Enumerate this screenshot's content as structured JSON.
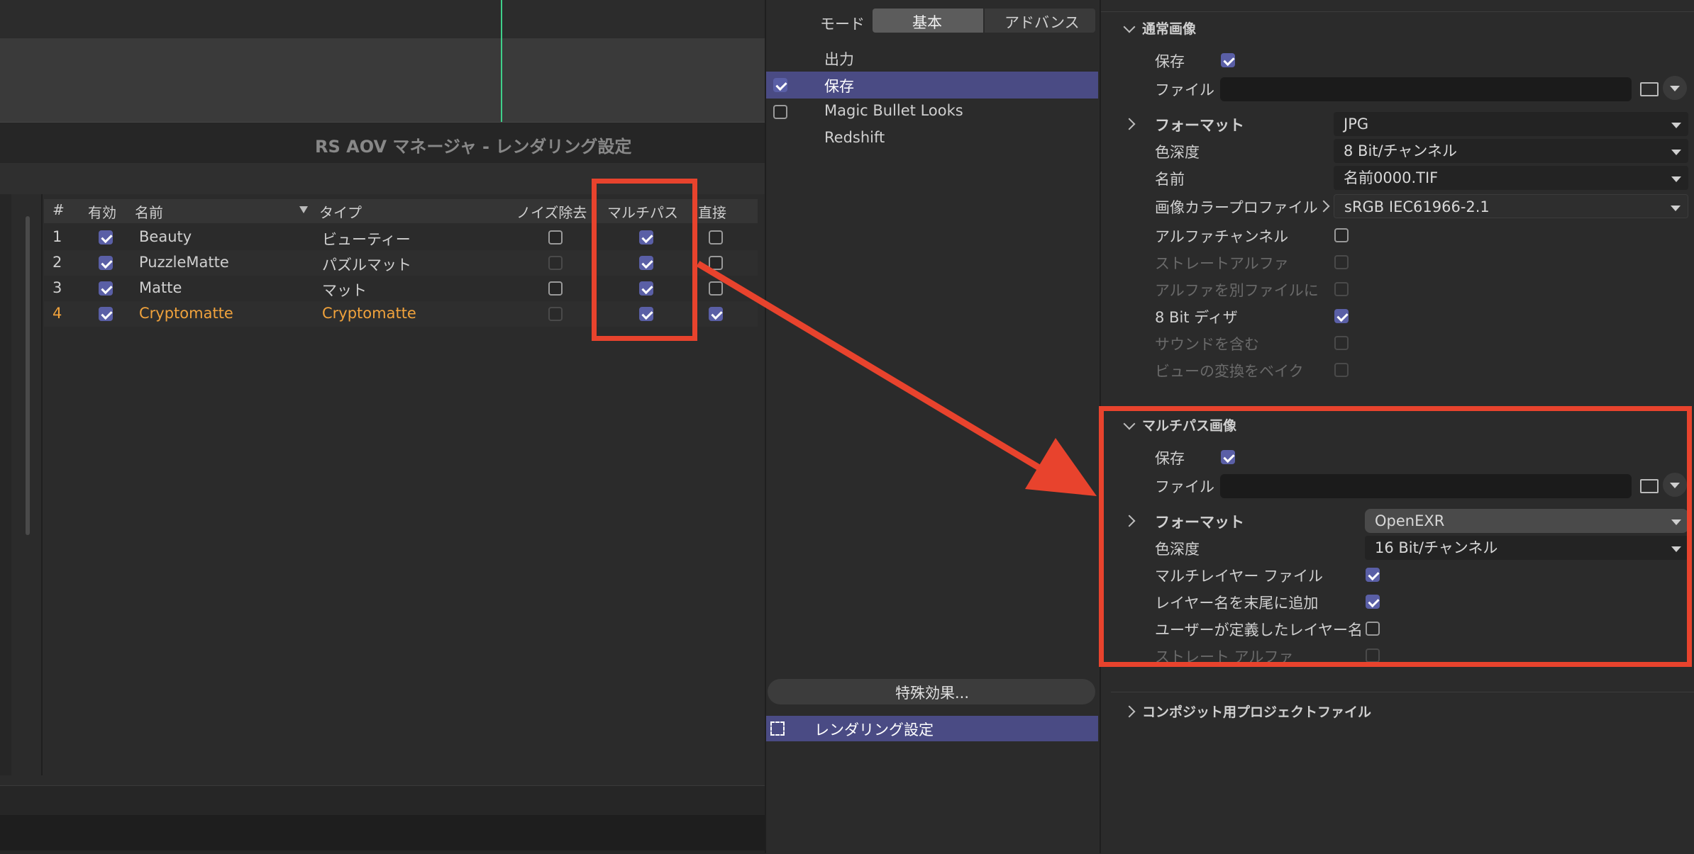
{
  "aov_manager": {
    "title": "RS AOV マネージャ - レンダリング設定",
    "columns": {
      "num": "#",
      "enabled": "有効",
      "name": "名前",
      "type": "タイプ",
      "denoise": "ノイズ除去",
      "multipass": "マルチパス",
      "direct": "直接"
    },
    "rows": [
      {
        "num": "1",
        "name": "Beauty",
        "type": "ビューティー",
        "enabled": true,
        "denoise": "off",
        "multipass": true,
        "direct": "off"
      },
      {
        "num": "2",
        "name": "PuzzleMatte",
        "type": "パズルマット",
        "enabled": true,
        "denoise": "disabled",
        "multipass": true,
        "direct": "off"
      },
      {
        "num": "3",
        "name": "Matte",
        "type": "マット",
        "enabled": true,
        "denoise": "off",
        "multipass": true,
        "direct": "off"
      },
      {
        "num": "4",
        "name": "Cryptomatte",
        "type": "Cryptomatte",
        "enabled": true,
        "denoise": "disabled",
        "multipass": true,
        "direct": "on",
        "highlight_color": "#f0a23c"
      }
    ]
  },
  "render_settings": {
    "mode_label": "モード",
    "mode_tabs": [
      "基本",
      "アドバンス"
    ],
    "active_mode": "基本",
    "list": [
      {
        "label": "出力",
        "checkbox": "none"
      },
      {
        "label": "保存",
        "checkbox": "on",
        "selected": true
      },
      {
        "label": "Magic Bullet Looks",
        "checkbox": "off"
      },
      {
        "label": "Redshift",
        "checkbox": "none"
      }
    ],
    "effects_button": "特殊効果...",
    "preset": "レンダリング設定"
  },
  "regular_image": {
    "section_title": "通常画像",
    "save_label": "保存",
    "file_label": "ファイル",
    "format_label": "フォーマット",
    "format_value": "JPG",
    "depth_label": "色深度",
    "depth_value": "8 Bit/チャンネル",
    "name_label": "名前",
    "name_value": "名前0000.TIF",
    "profile_label": "画像カラープロファイル",
    "profile_value": "sRGB IEC61966-2.1",
    "alpha_label": "アルファチャンネル",
    "straight_alpha_label": "ストレートアルファ",
    "separate_alpha_label": "アルファを別ファイルに",
    "dither_label": "8 Bit ディザ",
    "sound_label": "サウンドを含む",
    "bake_view_label": "ビューの変換をベイク"
  },
  "multipass_image": {
    "section_title": "マルチパス画像",
    "save_label": "保存",
    "file_label": "ファイル",
    "format_label": "フォーマット",
    "format_value": "OpenEXR",
    "depth_label": "色深度",
    "depth_value": "16 Bit/チャンネル",
    "multilayer_label": "マルチレイヤー ファイル",
    "append_layer_label": "レイヤー名を末尾に追加",
    "user_layer_label": "ユーザーが定義したレイヤー名",
    "straight_alpha_label": "ストレート アルファ"
  },
  "composite_section": {
    "title": "コンポジット用プロジェクトファイル"
  },
  "colors": {
    "accent": "#5a5fa6",
    "annotation": "#e8432d",
    "highlight": "#f0a23c"
  }
}
